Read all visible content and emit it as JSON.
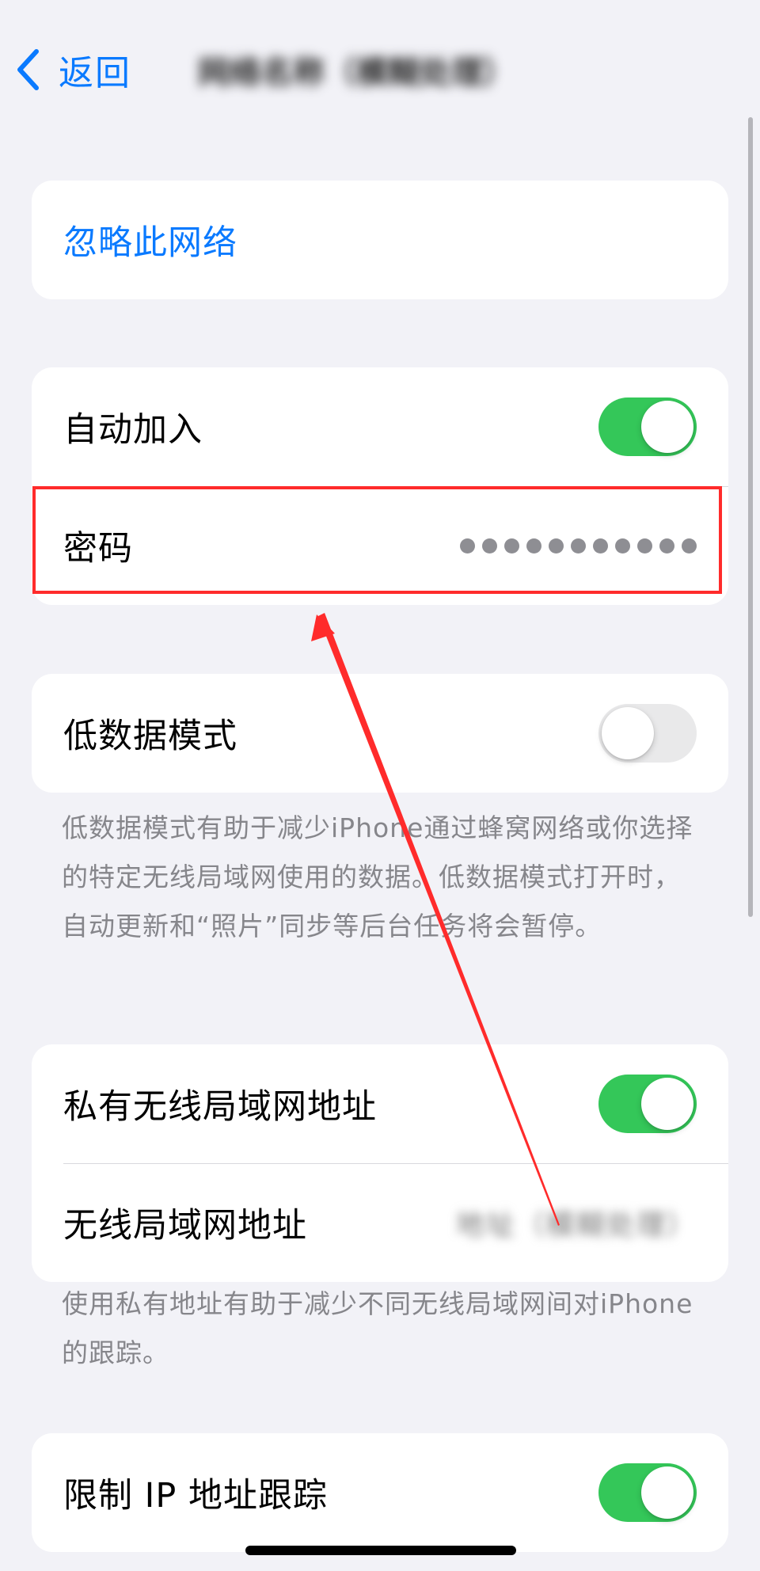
{
  "nav": {
    "back_label": "返回",
    "network_name": "网络名称（模糊处理）"
  },
  "sections": {
    "forget": {
      "label": "忽略此网络"
    },
    "join": {
      "auto_join_label": "自动加入",
      "auto_join_on": true,
      "password_label": "密码",
      "password_mask_length": 11
    },
    "low_data": {
      "label": "低数据模式",
      "on": false,
      "footer": "低数据模式有助于减少iPhone通过蜂窝网络或你选择的特定无线局域网使用的数据。低数据模式打开时，自动更新和“照片”同步等后台任务将会暂停。"
    },
    "private_address": {
      "label": "私有无线局域网地址",
      "on": true,
      "wifi_address_label": "无线局域网地址",
      "wifi_address_value": "地址（模糊处理）",
      "footer": "使用私有地址有助于减少不同无线局域网间对iPhone的跟踪。"
    },
    "limit_ip": {
      "label": "限制 IP 地址跟踪",
      "on": true
    }
  },
  "annotation": {
    "highlight_color": "#ff2b2b"
  },
  "colors": {
    "accent": "#0a7aff",
    "toggle_on": "#34c759",
    "background": "#f2f2f7"
  }
}
